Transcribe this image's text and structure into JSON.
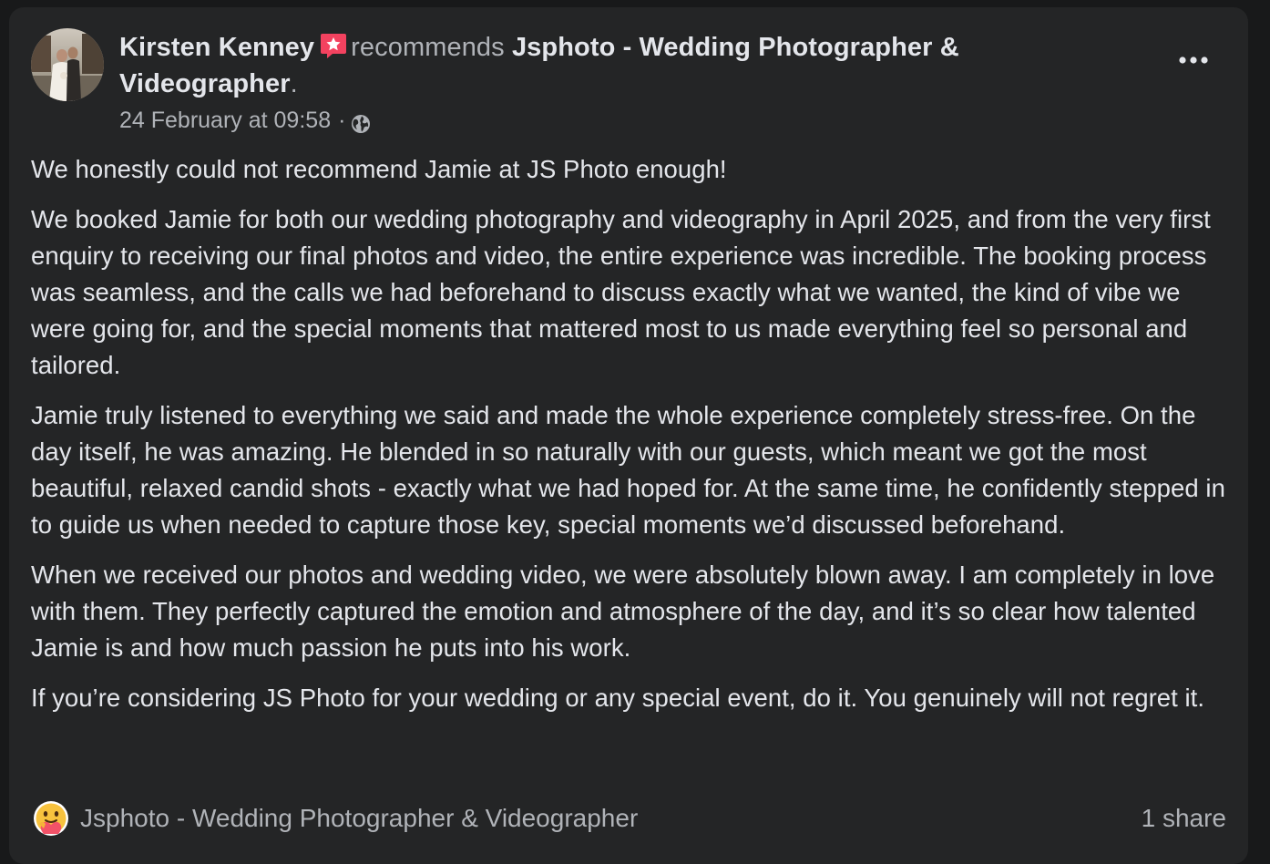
{
  "post": {
    "author": "Kirsten Kenney",
    "verb": "recommends",
    "page_name": "Jsphoto - Wedding Photographer & Videographer",
    "page_suffix": ".",
    "timestamp": "24 February at 09:58",
    "separator": "·",
    "privacy_icon": "globe-icon",
    "badge_icon": "recommendation-star-icon",
    "menu_icon": "more-options-icon",
    "paragraphs": [
      "We honestly could not recommend Jamie at JS Photo enough!",
      "We booked Jamie for both our wedding photography and videography in April 2025, and from the very first enquiry to receiving our final photos and video, the entire experience was incredible. The booking process was seamless, and the calls we had beforehand to discuss exactly what we wanted, the kind of vibe we were going for, and the special moments that mattered most to us made everything feel so personal and tailored.",
      "Jamie truly listened to everything we said and made the whole experience completely stress-free. On the day itself, he was amazing. He blended in so naturally with our guests, which meant we got the most beautiful, relaxed candid shots - exactly what we had hoped for. At the same time, he confidently stepped in to guide us when needed to capture those key, special moments we’d discussed beforehand.",
      "When we received our photos and wedding video, we were absolutely blown away. I am completely in love with them. They perfectly captured the emotion and atmosphere of the day, and it’s so clear how talented Jamie is and how much passion he puts into his work.",
      "If you’re considering JS Photo for your wedding or any special event, do it. You genuinely will not regret it."
    ]
  },
  "footer": {
    "reaction_icon": "care-reaction-icon",
    "reaction_label": "Jsphoto - Wedding Photographer & Videographer",
    "share_count": "1 share"
  },
  "colors": {
    "background": "#18191a",
    "card": "#242526",
    "primary_text": "#e4e6eb",
    "secondary_text": "#b0b3b8",
    "badge": "#f3425f"
  }
}
